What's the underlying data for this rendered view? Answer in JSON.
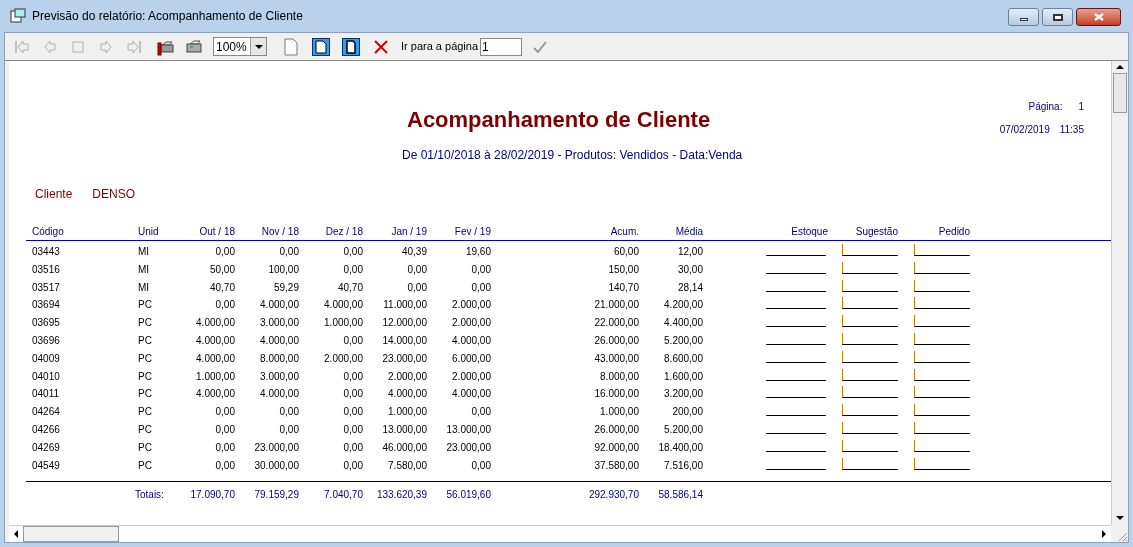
{
  "window": {
    "title": "Previsão do relatório: Acompanhamento de Cliente"
  },
  "toolbar": {
    "buttons": [
      {
        "kind": "first",
        "disabled": true
      },
      {
        "kind": "prev",
        "disabled": true
      },
      {
        "kind": "stop",
        "disabled": true
      },
      {
        "kind": "next",
        "disabled": true
      },
      {
        "kind": "last",
        "disabled": true
      },
      {
        "kind": "print-setup",
        "disabled": false
      },
      {
        "kind": "print",
        "disabled": false
      }
    ],
    "zoom": "100%",
    "page_buttons": [
      {
        "kind": "single",
        "selected": false
      },
      {
        "kind": "wide",
        "selected": false
      },
      {
        "kind": "full",
        "selected": false
      },
      {
        "kind": "close",
        "selected": false
      }
    ],
    "goto_label": "Ir para a página",
    "goto_value": "1",
    "confirm_disabled": true
  },
  "report": {
    "title": "Acompanhamento de Cliente",
    "subtitle": "De 01/10/2018 à 28/02/2019 - Produtos: Vendidos - Data:Venda",
    "page_label": "Página:",
    "page_number": "1",
    "date": "07/02/2019",
    "time": "11:35",
    "client_label": "Cliente",
    "client_name": "DENSO",
    "columns": [
      "Código",
      "Unid",
      "Out / 18",
      "Nov / 18",
      "Dez / 18",
      "Jan / 19",
      "Fev / 19",
      "Acum.",
      "Média",
      "Estoque",
      "Sugestão",
      "Pedido"
    ],
    "rows": [
      [
        "03443",
        "MI",
        "0,00",
        "0,00",
        "0,00",
        "40,39",
        "19,60",
        "60,00",
        "12,00"
      ],
      [
        "03516",
        "MI",
        "50,00",
        "100,00",
        "0,00",
        "0,00",
        "0,00",
        "150,00",
        "30,00"
      ],
      [
        "03517",
        "MI",
        "40,70",
        "59,29",
        "40,70",
        "0,00",
        "0,00",
        "140,70",
        "28,14"
      ],
      [
        "03694",
        "PC",
        "0,00",
        "4.000,00",
        "4.000,00",
        "11.000,00",
        "2.000,00",
        "21.000,00",
        "4.200,00"
      ],
      [
        "03695",
        "PC",
        "4.000,00",
        "3.000,00",
        "1.000,00",
        "12.000,00",
        "2.000,00",
        "22.000,00",
        "4.400,00"
      ],
      [
        "03696",
        "PC",
        "4.000,00",
        "4.000,00",
        "0,00",
        "14.000,00",
        "4.000,00",
        "26.000,00",
        "5.200,00"
      ],
      [
        "04009",
        "PC",
        "4.000,00",
        "8.000,00",
        "2.000,00",
        "23.000,00",
        "6.000,00",
        "43.000,00",
        "8.600,00"
      ],
      [
        "04010",
        "PC",
        "1.000,00",
        "3.000,00",
        "0,00",
        "2.000,00",
        "2.000,00",
        "8.000,00",
        "1.600,00"
      ],
      [
        "04011",
        "PC",
        "4.000,00",
        "4.000,00",
        "0,00",
        "4.000,00",
        "4.000,00",
        "16.000,00",
        "3.200,00"
      ],
      [
        "04264",
        "PC",
        "0,00",
        "0,00",
        "0,00",
        "1.000,00",
        "0,00",
        "1.000,00",
        "200,00"
      ],
      [
        "04266",
        "PC",
        "0,00",
        "0,00",
        "0,00",
        "13.000,00",
        "13.000,00",
        "26.000,00",
        "5.200,00"
      ],
      [
        "04269",
        "PC",
        "0,00",
        "23.000,00",
        "0,00",
        "46.000,00",
        "23.000,00",
        "92.000,00",
        "18.400,00"
      ],
      [
        "04549",
        "PC",
        "0,00",
        "30.000,00",
        "0,00",
        "7.580,00",
        "0,00",
        "37.580,00",
        "7.516,00"
      ]
    ],
    "totals_label": "Totais:",
    "totals": [
      "17.090,70",
      "79.159,29",
      "7.040,70",
      "133.620,39",
      "56.019,60",
      "292.930,70",
      "58.586,14"
    ]
  }
}
